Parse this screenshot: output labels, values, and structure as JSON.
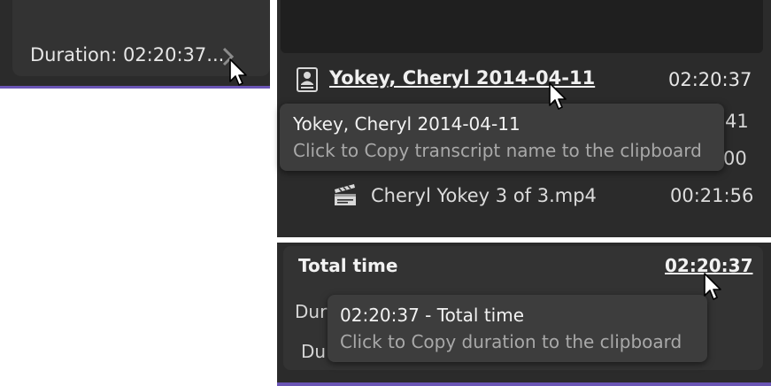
{
  "left_panel": {
    "duration_text": "Duration: 02:20:37..."
  },
  "transcript": {
    "name": "Yokey, Cheryl 2014-04-11",
    "duration": "02:20:37",
    "icon": "transcript-icon"
  },
  "rows": [
    {
      "duration": "41"
    },
    {
      "duration": "00"
    }
  ],
  "clip": {
    "name": "Cheryl Yokey 3 of 3.mp4",
    "duration": "00:21:56",
    "icon": "clapperboard-icon"
  },
  "total": {
    "label": "Total time",
    "value": "02:20:37",
    "fragments": [
      "Dur",
      "Du"
    ]
  },
  "tooltips": {
    "transcript": {
      "title": "Yokey, Cheryl 2014-04-11",
      "hint": "Click to Copy transcript name to the clipboard"
    },
    "duration": {
      "title": "02:20:37 - Total time",
      "hint": "Click to Copy duration to the clipboard"
    }
  },
  "colors": {
    "panel_bg": "#2b2b2b",
    "accent_border": "#6a55b5",
    "tooltip_bg": "#3d3d3d"
  }
}
